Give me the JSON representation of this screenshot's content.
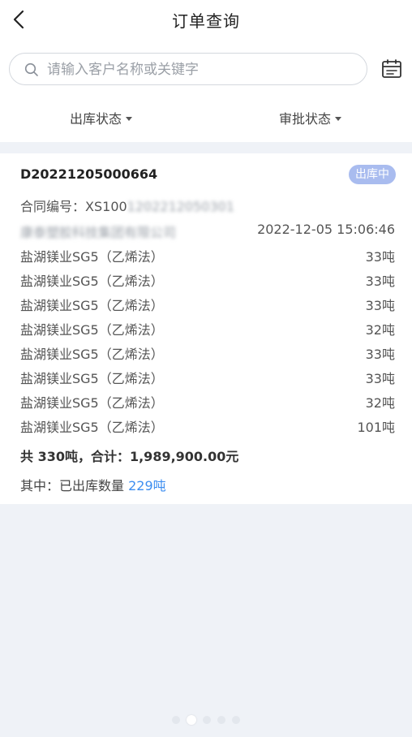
{
  "header": {
    "title": "订单查询"
  },
  "search": {
    "placeholder": "请输入客户名称或关键字"
  },
  "filters": {
    "stock_status": "出库状态",
    "approval_status": "审批状态"
  },
  "order": {
    "number": "D20221205000664",
    "status": "出库中",
    "contract_label": "合同编号：",
    "contract_number": "XS100",
    "contract_number_blurred": "1202212050301",
    "customer_blurred": "康泰塑胶科技集团有限公司",
    "datetime": "2022-12-05 15:06:46",
    "items": [
      {
        "name": "盐湖镁业SG5（乙烯法）",
        "qty": "33吨"
      },
      {
        "name": "盐湖镁业SG5（乙烯法）",
        "qty": "33吨"
      },
      {
        "name": "盐湖镁业SG5（乙烯法）",
        "qty": "33吨"
      },
      {
        "name": "盐湖镁业SG5（乙烯法）",
        "qty": "32吨"
      },
      {
        "name": "盐湖镁业SG5（乙烯法）",
        "qty": "33吨"
      },
      {
        "name": "盐湖镁业SG5（乙烯法）",
        "qty": "33吨"
      },
      {
        "name": "盐湖镁业SG5（乙烯法）",
        "qty": "32吨"
      },
      {
        "name": "盐湖镁业SG5（乙烯法）",
        "qty": "101吨"
      }
    ],
    "summary": "共 330吨，合计：1,989,900.00元",
    "shipped_label": "其中：已出库数量 ",
    "shipped_qty": "229吨"
  },
  "pager": {
    "count": 5,
    "active": 1
  },
  "colors": {
    "accent": "#3d8ef0",
    "badge": "#a9bcef",
    "background": "#eff2f7"
  }
}
